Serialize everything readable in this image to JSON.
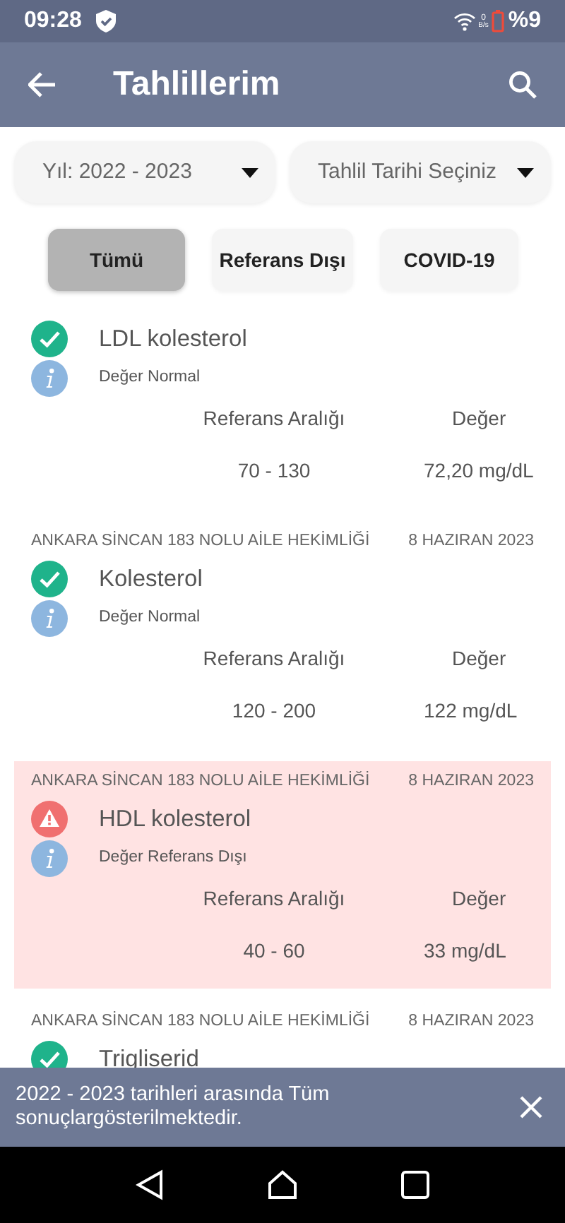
{
  "status_bar": {
    "time": "09:28",
    "rate_value": "0",
    "rate_unit": "B/s",
    "battery": "%9"
  },
  "app_bar": {
    "title": "Tahlillerim"
  },
  "dropdowns": [
    {
      "label": "Yıl: 2022 - 2023"
    },
    {
      "label": "Tahlil Tarihi Seçiniz"
    }
  ],
  "chips": [
    {
      "label": "Tümü",
      "selected": true
    },
    {
      "label": "Referans Dışı",
      "selected": false
    },
    {
      "label": "COVID-19",
      "selected": false
    }
  ],
  "results": [
    {
      "name": "LDL kolesterol",
      "kind": "normal",
      "note": "Değer Normal",
      "range_label": "Referans Aralığı",
      "value_label": "Değer",
      "range": "70 - 130",
      "value": "72,20 mg/dL"
    },
    {
      "source": "ANKARA SİNCAN 183 NOLU AİLE HEKİMLİĞİ",
      "date": "8 HAZIRAN 2023",
      "name": "Kolesterol",
      "kind": "normal",
      "note": "Değer Normal",
      "range_label": "Referans Aralığı",
      "value_label": "Değer",
      "range": "120 - 200",
      "value": "122 mg/dL"
    },
    {
      "source": "ANKARA SİNCAN 183 NOLU AİLE HEKİMLİĞİ",
      "date": "8 HAZIRAN 2023",
      "name": "HDL kolesterol",
      "kind": "abnormal",
      "note": "Değer Referans Dışı",
      "range_label": "Referans Aralığı",
      "value_label": "Değer",
      "range": "40 - 60",
      "value": "33 mg/dL"
    },
    {
      "source": "ANKARA SİNCAN 183 NOLU AİLE HEKİMLİĞİ",
      "date": "8 HAZIRAN 2023",
      "name": "Trigliserid",
      "kind": "normal"
    }
  ],
  "snackbar": {
    "message": "2022 - 2023 tarihleri arasında Tüm sonuçlargösterilmektedir."
  }
}
